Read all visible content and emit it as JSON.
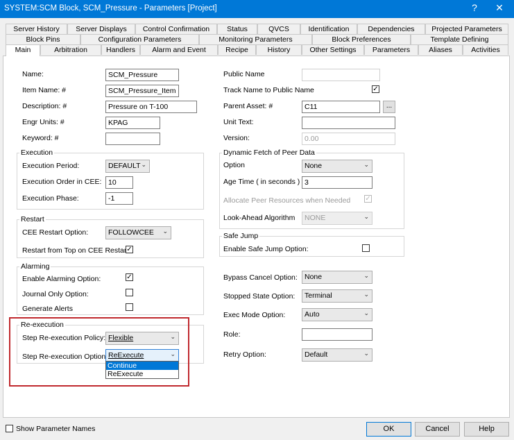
{
  "window": {
    "title": "SYSTEM:SCM Block, SCM_Pressure - Parameters [Project]",
    "help_glyph": "?",
    "close_glyph": "✕"
  },
  "tabs": {
    "row1": [
      "Server History",
      "Server Displays",
      "Control Confirmation",
      "Status",
      "QVCS",
      "Identification",
      "Dependencies",
      "Projected Parameters"
    ],
    "row2": [
      "Block Pins",
      "Configuration Parameters",
      "Monitoring Parameters",
      "Block Preferences",
      "Template Defining"
    ],
    "row3": [
      "Main",
      "Arbitration",
      "Handlers",
      "Alarm and Event",
      "Recipe",
      "History",
      "Other Settings",
      "Parameters",
      "Aliases",
      "Activities"
    ],
    "active": "Main"
  },
  "fields": {
    "name": {
      "label": "Name:",
      "value": "SCM_Pressure"
    },
    "item_name": {
      "label": "Item Name: #",
      "value": "SCM_Pressure_Item"
    },
    "description": {
      "label": "Description: #",
      "value": "Pressure on T-100"
    },
    "engr_units": {
      "label": "Engr Units: #",
      "value": "KPAG"
    },
    "keyword": {
      "label": "Keyword: #",
      "value": ""
    },
    "public_name": {
      "label": "Public Name",
      "value": ""
    },
    "track_name": {
      "label": "Track Name to Public Name",
      "checked": true
    },
    "parent_asset": {
      "label": "Parent Asset: #",
      "value": "C11",
      "browse": "..."
    },
    "unit_text": {
      "label": "Unit Text:",
      "value": ""
    },
    "version": {
      "label": "Version:",
      "value": "0.00"
    }
  },
  "execution": {
    "title": "Execution",
    "period": {
      "label": "Execution Period:",
      "value": "DEFAULT"
    },
    "order": {
      "label": "Execution Order in CEE:",
      "value": "10"
    },
    "phase": {
      "label": "Execution Phase:",
      "value": "-1"
    }
  },
  "restart": {
    "title": "Restart",
    "option": {
      "label": "CEE Restart Option:",
      "value": "FOLLOWCEE"
    },
    "from_top": {
      "label": "Restart from Top on CEE Restart",
      "checked": true
    }
  },
  "alarming": {
    "title": "Alarming",
    "enable": {
      "label": "Enable Alarming Option:",
      "checked": true
    },
    "journal": {
      "label": "Journal Only Option:",
      "checked": false
    },
    "generate": {
      "label": "Generate Alerts",
      "checked": false
    }
  },
  "reexecution": {
    "title": "Re-execution",
    "policy": {
      "label": "Step Re-execution Policy:",
      "value": "Flexible"
    },
    "option": {
      "label": "Step Re-execution Option:",
      "value": "ReExecute"
    },
    "dropdown_options": [
      "Continue",
      "ReExecute"
    ],
    "highlighted_option": "Continue"
  },
  "peer": {
    "title": "Dynamic Fetch of Peer Data",
    "option": {
      "label": "Option",
      "value": "None"
    },
    "age": {
      "label": "Age Time ( in seconds )",
      "value": "3"
    },
    "allocate": {
      "label": "Allocate Peer Resources when Needed",
      "checked": true
    },
    "lookahead": {
      "label": "Look-Ahead Algorithm",
      "value": "NONE"
    }
  },
  "safe_jump": {
    "title": "Safe Jump",
    "enable": {
      "label": "Enable Safe Jump Option:",
      "checked": false
    }
  },
  "misc": {
    "bypass": {
      "label": "Bypass Cancel Option:",
      "value": "None"
    },
    "stopped": {
      "label": "Stopped State Option:",
      "value": "Terminal"
    },
    "exec_mode": {
      "label": "Exec Mode Option:",
      "value": "Auto"
    },
    "role": {
      "label": "Role:",
      "value": ""
    },
    "retry": {
      "label": "Retry Option:",
      "value": "Default"
    }
  },
  "footer": {
    "show_names": {
      "label": "Show Parameter Names",
      "checked": false
    },
    "ok": "OK",
    "cancel": "Cancel",
    "help": "Help"
  },
  "colors": {
    "titlebar": "#0078d7",
    "highlight": "#c0282d"
  }
}
